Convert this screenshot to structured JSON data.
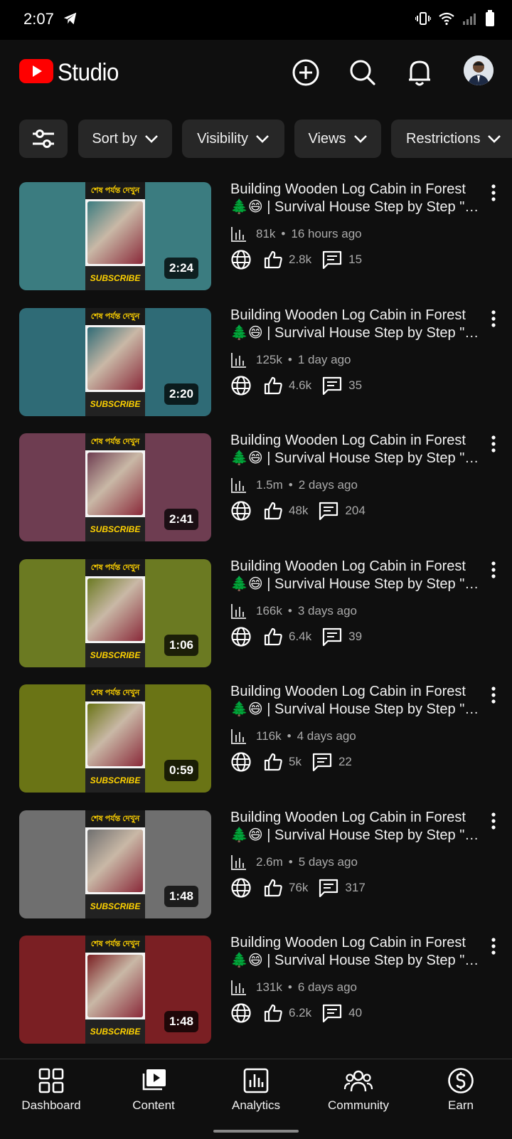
{
  "status_bar": {
    "time": "2:07"
  },
  "header": {
    "app_name": "Studio",
    "brand_color": "#ff0000"
  },
  "filters": [
    {
      "label": "Sort by"
    },
    {
      "label": "Visibility"
    },
    {
      "label": "Views"
    },
    {
      "label": "Restrictions"
    }
  ],
  "videos": [
    {
      "title_line1": "Building Wooden Log Cabin in Forest",
      "title_line2": "🌲😄 | Survival House Step by Step \"7…",
      "views": "81k",
      "age": "16 hours ago",
      "likes": "2.8k",
      "comments": "15",
      "duration": "2:24",
      "thumb_color": "#3b7c80",
      "thumb_text": "শেষ পর্যন্ত দেখুন",
      "thumb_sub": "SUBSCRIBE"
    },
    {
      "title_line1": "Building Wooden Log Cabin in Forest",
      "title_line2": "🌲😄 | Survival House Step by Step \"7…",
      "views": "125k",
      "age": "1 day ago",
      "likes": "4.6k",
      "comments": "35",
      "duration": "2:20",
      "thumb_color": "#2f6b76",
      "thumb_text": "শেষ পর্যন্ত দেখুন",
      "thumb_sub": "SUBSCRIBE"
    },
    {
      "title_line1": "Building Wooden Log Cabin in Forest",
      "title_line2": "🌲😄 | Survival House Step by Step \"7…",
      "views": "1.5m",
      "age": "2 days ago",
      "likes": "48k",
      "comments": "204",
      "duration": "2:41",
      "thumb_color": "#6e3d51",
      "thumb_text": "শেষ পর্যন্ত দেখুন",
      "thumb_sub": "SUBSCRIBE"
    },
    {
      "title_line1": "Building Wooden Log Cabin in Forest",
      "title_line2": "🌲😄 | Survival House Step by Step \"7…",
      "views": "166k",
      "age": "3 days ago",
      "likes": "6.4k",
      "comments": "39",
      "duration": "1:06",
      "thumb_color": "#6b7a22",
      "thumb_text": "শেষ পর্যন্ত দেখুন",
      "thumb_sub": "SUBSCRIBE"
    },
    {
      "title_line1": "Building Wooden Log Cabin in Forest",
      "title_line2": "🌲😄 | Survival House Step by Step \"7…",
      "views": "116k",
      "age": "4 days ago",
      "likes": "5k",
      "comments": "22",
      "duration": "0:59",
      "thumb_color": "#6a7415",
      "thumb_text": "শেষ পর্যন্ত দেখুন",
      "thumb_sub": "SUBSCRIBE"
    },
    {
      "title_line1": "Building Wooden Log Cabin in Forest",
      "title_line2": "🌲😄 | Survival House Step by Step \"7…",
      "views": "2.6m",
      "age": "5 days ago",
      "likes": "76k",
      "comments": "317",
      "duration": "1:48",
      "thumb_color": "#6f6f6f",
      "thumb_text": "শেষ পর্যন্ত দেখুন",
      "thumb_sub": "SUBSCRIBE"
    },
    {
      "title_line1": "Building Wooden Log Cabin in Forest",
      "title_line2": "🌲😄 | Survival House Step by Step \"7…",
      "views": "131k",
      "age": "6 days ago",
      "likes": "6.2k",
      "comments": "40",
      "duration": "1:48",
      "thumb_color": "#7a1f23",
      "thumb_text": "শেষ পর্যন্ত দেখুন",
      "thumb_sub": "SUBSCRIBE"
    }
  ],
  "nav": [
    {
      "label": "Dashboard",
      "icon": "dashboard-icon"
    },
    {
      "label": "Content",
      "icon": "content-icon"
    },
    {
      "label": "Analytics",
      "icon": "analytics-icon"
    },
    {
      "label": "Community",
      "icon": "community-icon"
    },
    {
      "label": "Earn",
      "icon": "earn-icon"
    }
  ]
}
